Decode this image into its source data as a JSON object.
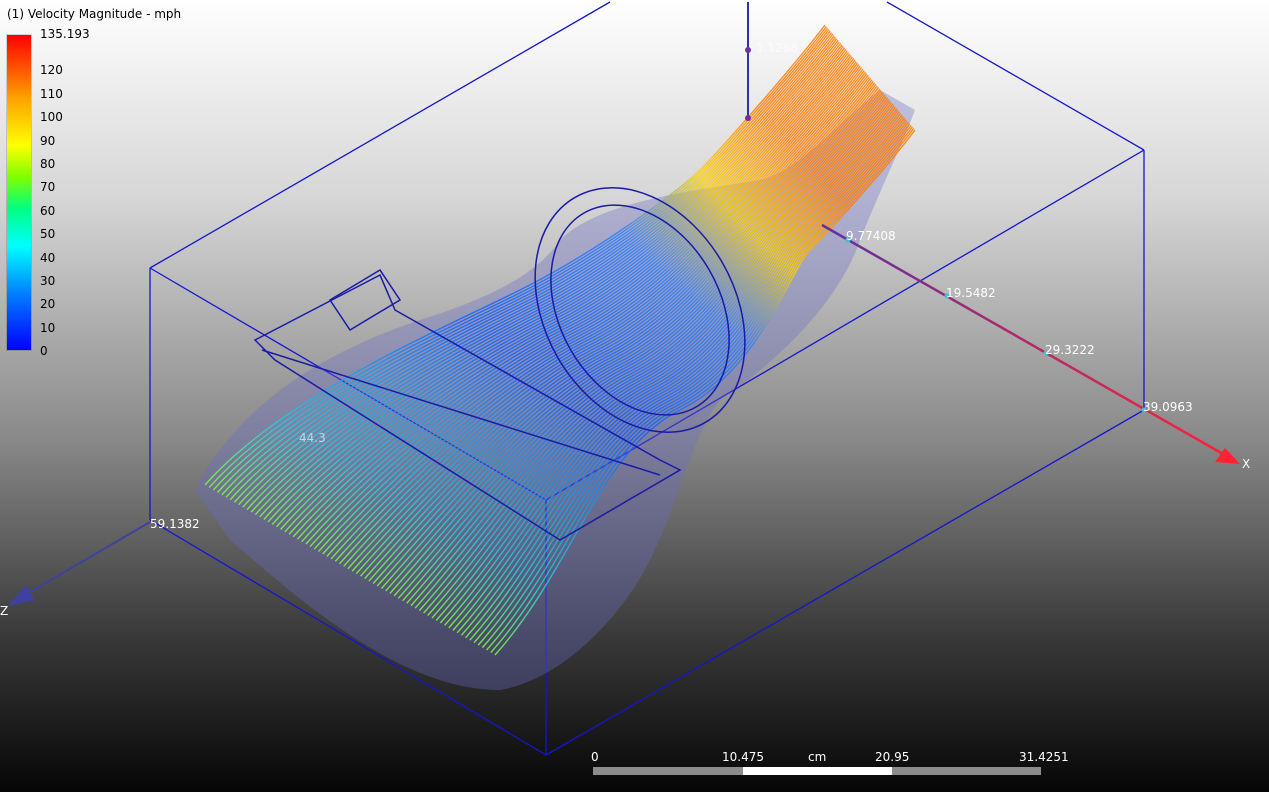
{
  "legend": {
    "title": "(1) Velocity Magnitude - mph",
    "max_label": "135.193",
    "ticks": [
      "120",
      "110",
      "100",
      "90",
      "80",
      "70",
      "60",
      "50",
      "40",
      "30",
      "20",
      "10",
      "0"
    ]
  },
  "axes": {
    "x_axis_name": "X",
    "z_axis_name": "Z",
    "x_ticks": [
      "9.77408",
      "19.5482",
      "29.3222",
      "39.0963"
    ],
    "y_tick_top": "1.1268",
    "z_tick": "59.1382",
    "partial_label": "44.3"
  },
  "scale_bar": {
    "unit": "cm",
    "labels": [
      "0",
      "10.475",
      "20.95",
      "31.4251"
    ]
  },
  "colors": {
    "axis_x": "#ff2233",
    "axis_z": "#4040a0",
    "bbox": "#1515d0",
    "background_top": "#ffffff",
    "background_bottom": "#060606"
  }
}
